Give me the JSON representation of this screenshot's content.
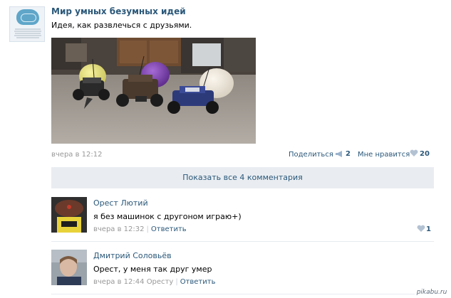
{
  "post": {
    "group_name": "Мир умных безумных идей",
    "text": "Идея, как развлечься с друзьями.",
    "time": "вчера в 12:12",
    "share_label": "Поделиться",
    "share_icon": "megaphone-icon",
    "share_count": "2",
    "like_label": "Мне нравится",
    "like_icon": "heart-icon",
    "like_count": "20"
  },
  "show_comments_label": "Показать все 4 комментария",
  "comments": [
    {
      "author": "Орест Лютий",
      "text": "я без машинок с другоном играю+)",
      "time": "вчера в 12:32",
      "separator": "|",
      "reply_label": "Ответить",
      "like_count": "1"
    },
    {
      "author": "Дмитрий Соловьёв",
      "text": "Орест, у меня так друг умер",
      "time": "вчера в 12:44",
      "to": "Оресту",
      "separator": "|",
      "reply_label": "Ответить"
    }
  ],
  "watermark": "pikabu.ru",
  "colors": {
    "link": "#2b587a",
    "muted": "#999999",
    "bar_bg": "#e9edf1",
    "icon": "#b3c2d3"
  }
}
